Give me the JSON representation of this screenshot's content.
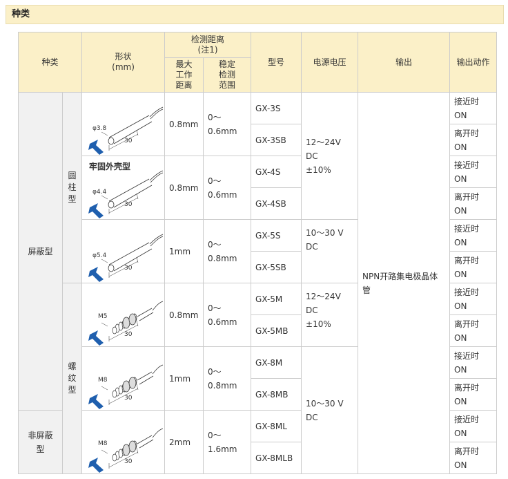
{
  "section": {
    "title": "种类"
  },
  "header": {
    "kind": "种类",
    "shape": "形状\n(mm)",
    "detect_range": "检测距离\n(注1)",
    "max_distance": "最大\n工作\n距离",
    "stable_range": "稳定\n检测\n范围",
    "model": "型号",
    "voltage": "电源电压",
    "output": "输出",
    "output_action": "输出动作"
  },
  "category": {
    "shielded": "屏蔽型",
    "non_shielded": "非屏蔽\n型",
    "cylindrical": "圆\n柱\n型",
    "threaded": "螺\n纹\n型"
  },
  "groups": [
    {
      "shape_label": "",
      "dim": "φ3.8",
      "len": "30",
      "max": "0.8mm",
      "stable": "0～\n0.6mm",
      "models": [
        "GX-3S",
        "GX-3SB"
      ]
    },
    {
      "shape_label": "牢固外壳型",
      "dim": "φ4.4",
      "len": "30",
      "max": "0.8mm",
      "stable": "0～\n0.6mm",
      "models": [
        "GX-4S",
        "GX-4SB"
      ]
    },
    {
      "shape_label": "",
      "dim": "φ5.4",
      "len": "30",
      "max": "1mm",
      "stable": "0～\n0.8mm",
      "models": [
        "GX-5S",
        "GX-5SB"
      ]
    },
    {
      "shape_label": "",
      "dim": "M5",
      "len": "30",
      "max": "0.8mm",
      "stable": "0～\n0.6mm",
      "models": [
        "GX-5M",
        "GX-5MB"
      ]
    },
    {
      "shape_label": "",
      "dim": "M8",
      "len": "30",
      "max": "1mm",
      "stable": "0～\n0.8mm",
      "models": [
        "GX-8M",
        "GX-8MB"
      ]
    },
    {
      "shape_label": "",
      "dim": "M8",
      "len": "30",
      "max": "2mm",
      "stable": "0～\n1.6mm",
      "models": [
        "GX-8ML",
        "GX-8MLB"
      ]
    }
  ],
  "voltages": {
    "v1": "12～24V\nDC\n±10%",
    "v2": "10～30 V\nDC",
    "v3": "12～24V\nDC\n±10%",
    "v4": "10～30 V\nDC"
  },
  "output_text": "NPN开路集电极晶体\n管",
  "actions": {
    "approach": "接近时\nON",
    "leave": "离开时\nON"
  }
}
